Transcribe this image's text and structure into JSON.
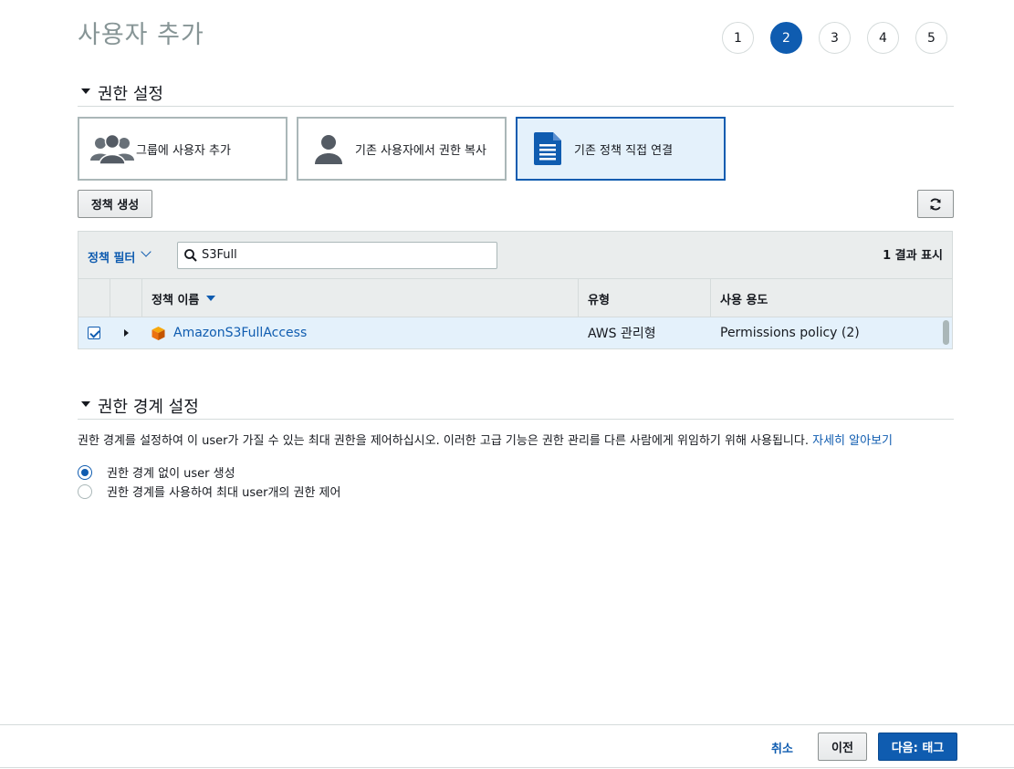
{
  "page": {
    "title": "사용자 추가"
  },
  "steps": [
    {
      "label": "1",
      "active": false
    },
    {
      "label": "2",
      "active": true
    },
    {
      "label": "3",
      "active": false
    },
    {
      "label": "4",
      "active": false
    },
    {
      "label": "5",
      "active": false
    }
  ],
  "permissions": {
    "section_title": "권한 설정",
    "options": [
      {
        "label": "그룹에 사용자 추가",
        "icon": "users-group-icon",
        "selected": false
      },
      {
        "label": "기존 사용자에서 권한 복사",
        "icon": "user-icon",
        "selected": false
      },
      {
        "label": "기존 정책 직접 연결",
        "icon": "document-icon",
        "selected": true
      }
    ],
    "create_policy_label": "정책 생성",
    "refresh_icon": "refresh-icon"
  },
  "policy_table": {
    "filter_label": "정책 필터",
    "search_value": "S3Full",
    "result_count": "1 결과 표시",
    "columns": [
      "정책 이름",
      "유형",
      "사용 용도"
    ],
    "rows": [
      {
        "checked": true,
        "name": "AmazonS3FullAccess",
        "type": "AWS 관리형",
        "used_as": "Permissions policy (2)"
      }
    ]
  },
  "boundary": {
    "section_title": "권한 경계 설정",
    "description": "권한 경계를 설정하여 이 user가 가질 수 있는 최대 권한을 제어하십시오. 이러한 고급 기능은 권한 관리를 다른 사람에게 위임하기 위해 사용됩니다.",
    "learn_more": "자세히 알아보기",
    "radio_options": [
      {
        "label": "권한 경계 없이 user 생성",
        "selected": true
      },
      {
        "label": "권한 경계를 사용하여 최대 user개의 권한 제어",
        "selected": false
      }
    ]
  },
  "footer": {
    "cancel_label": "취소",
    "previous_label": "이전",
    "next_label": "다음: 태그"
  },
  "colors": {
    "accent": "#0f5cb0",
    "selected_bg": "#e4f1fb",
    "aws_orange": "#ec7211"
  }
}
